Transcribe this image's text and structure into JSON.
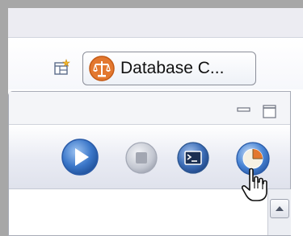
{
  "perspective_bar": {
    "open_perspective_icon": "open-perspective-icon",
    "active_perspective": {
      "label": "Database C...",
      "icon": "scales-icon",
      "icon_color": "#e3782f"
    }
  },
  "view": {
    "window_controls": {
      "minimize_icon": "minimize-icon",
      "maximize_icon": "maximize-icon"
    },
    "toolbar": {
      "buttons": [
        {
          "icon": "play-icon",
          "color": "#3b77c9"
        },
        {
          "icon": "stop-icon",
          "color": "#b8bcc7"
        },
        {
          "icon": "console-icon",
          "color": "#3f6fb8"
        },
        {
          "icon": "pie-chart-icon",
          "color": "#4a86d6"
        }
      ]
    },
    "scrollbar": {
      "up_icon": "scroll-up-icon"
    }
  },
  "colors": {
    "frame_background": "#a7a7a7",
    "accent_orange": "#e3782f"
  }
}
